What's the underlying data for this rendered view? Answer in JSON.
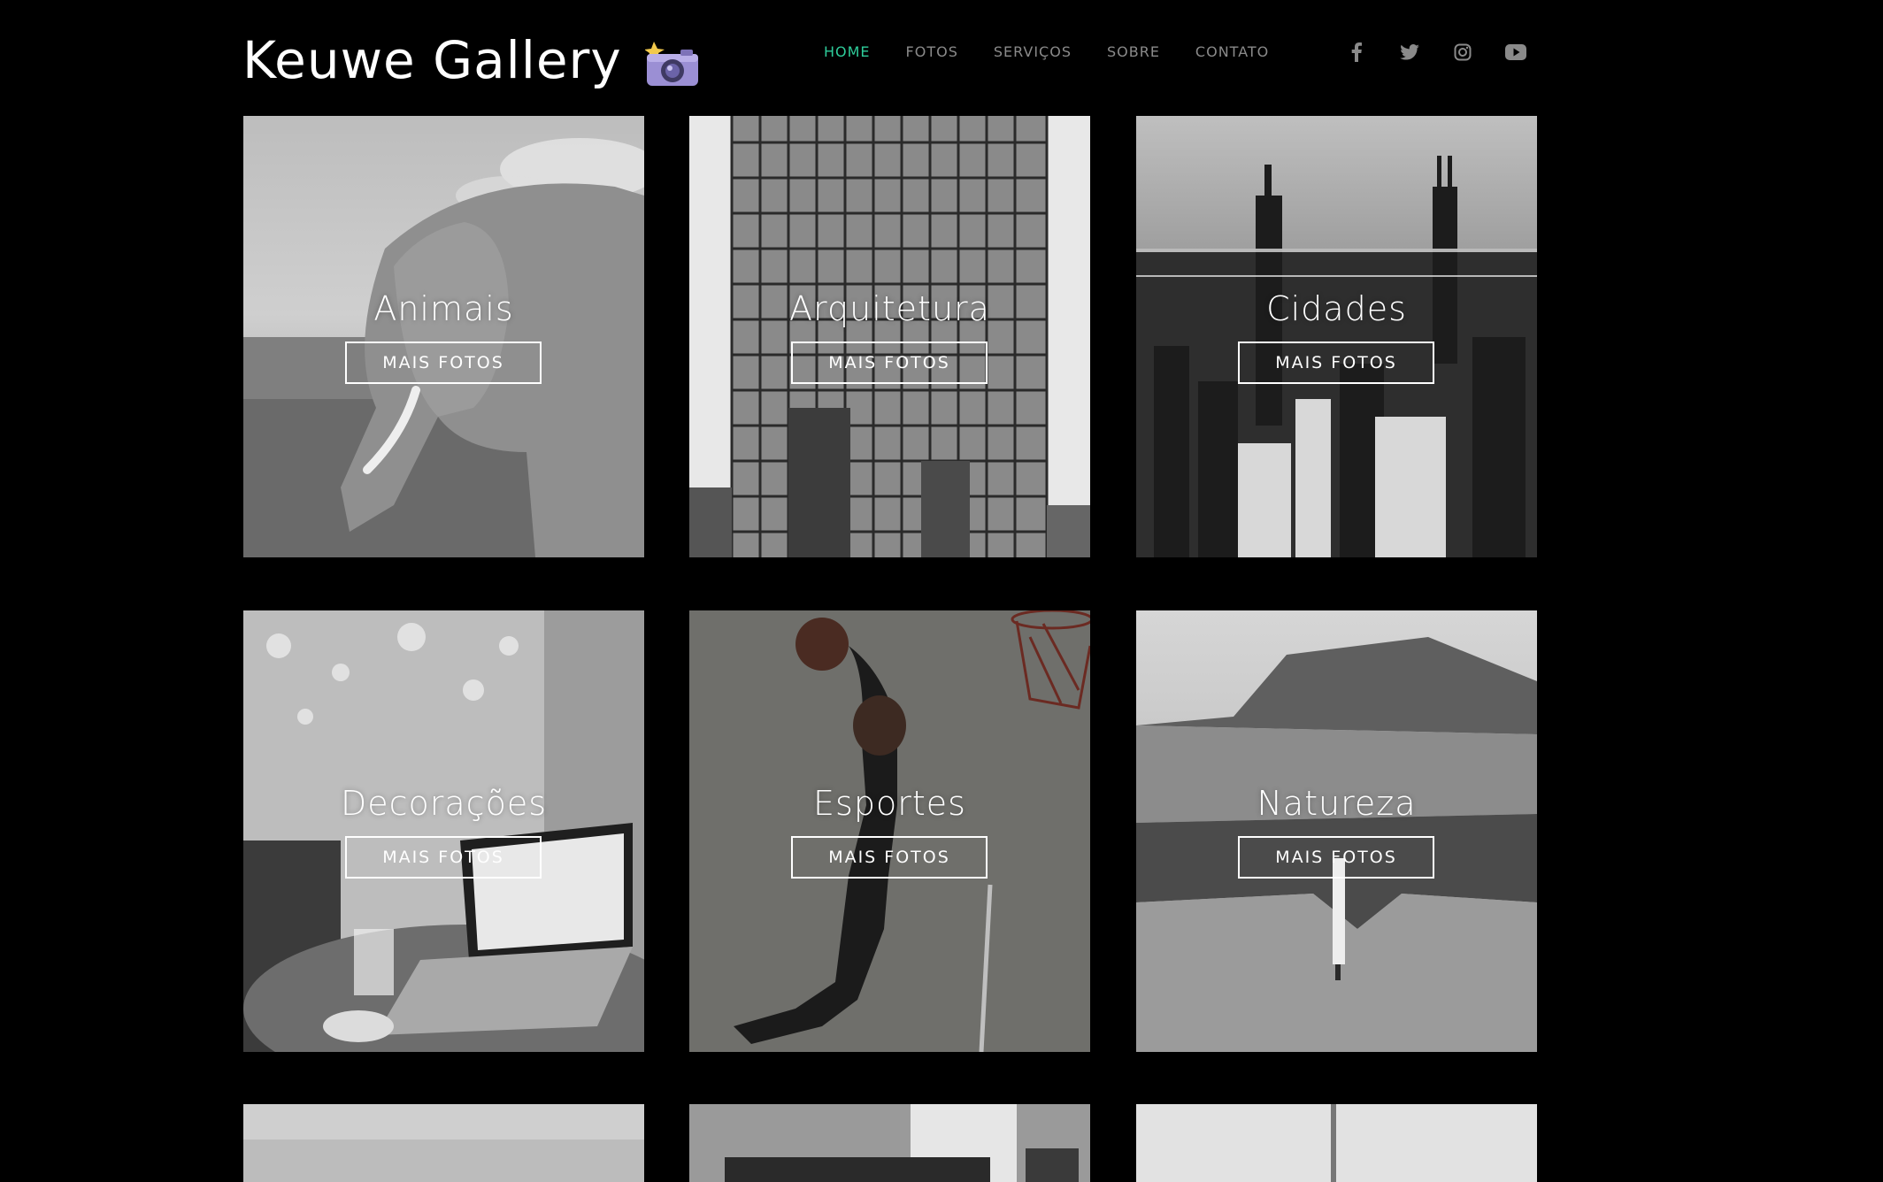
{
  "brand": {
    "name": "Keuwe Gallery",
    "logo_icon": "camera-with-flash-emoji"
  },
  "nav": {
    "items": [
      {
        "label": "HOME",
        "active": true
      },
      {
        "label": "FOTOS",
        "active": false
      },
      {
        "label": "SERVIÇOS",
        "active": false
      },
      {
        "label": "SOBRE",
        "active": false
      },
      {
        "label": "CONTATO",
        "active": false
      }
    ],
    "active_color": "#2ecc9a",
    "inactive_color": "#8a8a8a"
  },
  "social": {
    "icons": [
      "facebook-icon",
      "twitter-icon",
      "instagram-icon",
      "youtube-icon"
    ]
  },
  "gallery": {
    "button_label": "MAIS FOTOS",
    "tiles": [
      {
        "title": "Animais",
        "image": "black-and-white elephant in grass"
      },
      {
        "title": "Arquitetura",
        "image": "glass skyscraper facade"
      },
      {
        "title": "Cidades",
        "image": "aerial city skyline at dusk"
      },
      {
        "title": "Decorações",
        "image": "laptop on cafe table with glass"
      },
      {
        "title": "Esportes",
        "image": "basketball player dunking"
      },
      {
        "title": "Natureza",
        "image": "waterfall on a cliff with mountains"
      }
    ]
  }
}
